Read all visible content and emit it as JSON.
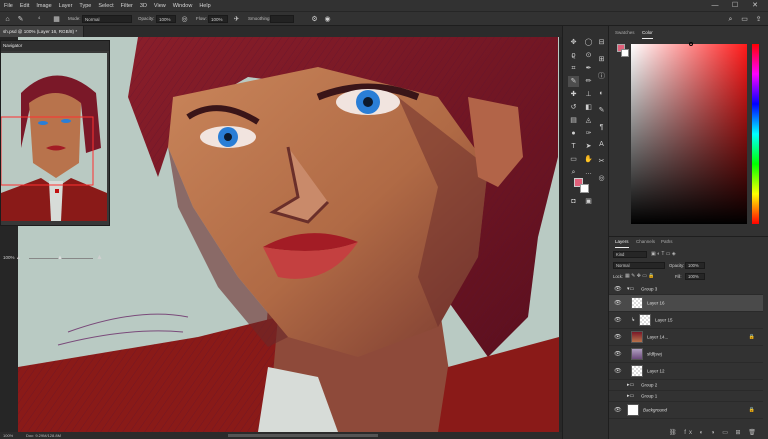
{
  "menu": [
    "File",
    "Edit",
    "Image",
    "Layer",
    "Type",
    "Select",
    "Filter",
    "3D",
    "View",
    "Window",
    "Help"
  ],
  "window_controls": {
    "minimize": "—",
    "maximize": "☐",
    "close": "✕"
  },
  "options": {
    "mode_label": "Mode:",
    "mode_value": "Normal",
    "opacity_label": "Opacity:",
    "opacity_value": "100%",
    "flow_label": "Flow:",
    "flow_value": "100%",
    "smoothing_label": "Smoothing:",
    "smoothing_value": "",
    "brush_size": "4"
  },
  "document_tab": "sh.psd @ 100% (Layer 16, RGB/8) *",
  "status_bar": {
    "zoom": "100%",
    "doc": "Doc: 9.29M/128.8M"
  },
  "navigator": {
    "title": "Navigator",
    "zoom": "100%"
  },
  "color_panel": {
    "tabs": [
      "Swatches",
      "Color"
    ],
    "active": "Color"
  },
  "layers_panel": {
    "tabs": [
      "Layers",
      "Channels",
      "Paths"
    ],
    "active": "Layers",
    "filter_kind": "Kind",
    "blend_mode": "Normal",
    "opacity_label": "Opacity:",
    "opacity_value": "100%",
    "lock_label": "Lock:",
    "fill_label": "Fill:",
    "fill_value": "100%",
    "layers": [
      {
        "name": "Group 3",
        "type": "group",
        "visible": true
      },
      {
        "name": "Layer 16",
        "type": "layer",
        "visible": true,
        "selected": true
      },
      {
        "name": "Layer 15",
        "type": "layer",
        "visible": true,
        "clipped": true
      },
      {
        "name": "Layer 14...",
        "type": "layer",
        "visible": true,
        "locked": true
      },
      {
        "name": "sfdfjswj",
        "type": "layer",
        "visible": true
      },
      {
        "name": "Layer 12",
        "type": "layer",
        "visible": true
      },
      {
        "name": "Group 2",
        "type": "group",
        "visible": false
      },
      {
        "name": "Group 1",
        "type": "group",
        "visible": false
      },
      {
        "name": "Background",
        "type": "layer",
        "visible": true,
        "locked": true
      }
    ]
  },
  "colors": {
    "foreground": "#e0607a",
    "background": "#ffffff",
    "accent": "#31a8ff"
  }
}
